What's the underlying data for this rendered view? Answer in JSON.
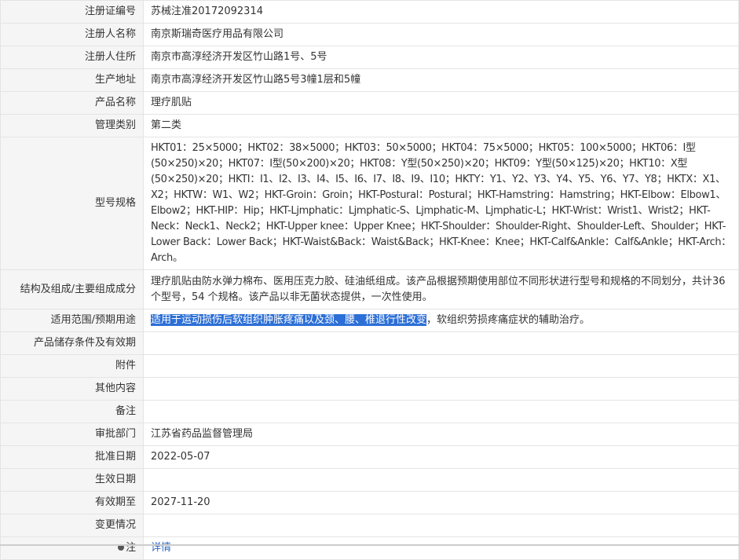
{
  "rows": [
    {
      "label": "注册证编号",
      "value": "苏械注准20172092314"
    },
    {
      "label": "注册人名称",
      "value": "南京斯瑞奇医疗用品有限公司"
    },
    {
      "label": "注册人住所",
      "value": "南京市高淳经济开发区竹山路1号、5号"
    },
    {
      "label": "生产地址",
      "value": "南京市高淳经济开发区竹山路5号3幢1层和5幢"
    },
    {
      "label": "产品名称",
      "value": "理疗肌贴"
    },
    {
      "label": "管理类别",
      "value": "第二类"
    },
    {
      "label": "型号规格",
      "value": "HKT01：25×5000；HKT02：38×5000；HKT03：50×5000；HKT04：75×5000；HKT05：100×5000；HKT06：I型(50×250)×20；HKT07：I型(50×200)×20；HKT08：Y型(50×250)×20；HKT09：Y型(50×125)×20；HKT10：X型(50×250)×20；HKTI：I1、I2、I3、I4、I5、I6、I7、I8、I9、I10；HKTY：Y1、Y2、Y3、Y4、Y5、Y6、Y7、Y8；HKTX：X1、X2；HKTW：W1、W2；HKT-Groin：Groin；HKT-Postural：Postural；HKT-Hamstring：Hamstring；HKT-Elbow：Elbow1、Elbow2；HKT-HIP：Hip；HKT-Ljmphatic：Ljmphatic-S、Ljmphatic-M、Ljmphatic-L；HKT-Wrist：Wrist1、Wrist2；HKT-Neck：Neck1、Neck2；HKT-Upper knee：Upper Knee；HKT-Shoulder：Shoulder-Right、Shoulder-Left、Shoulder；HKT-Lower Back：Lower Back；HKT-Waist&Back：Waist&Back；HKT-Knee：Knee；HKT-Calf&Ankle：Calf&Ankle；HKT-Arch：Arch。"
    },
    {
      "label": "结构及组成/主要组成成分",
      "value": "理疗肌贴由防水弹力棉布、医用压克力胶、硅油纸组成。该产品根据预期使用部位不同形状进行型号和规格的不同划分，共计36 个型号，54 个规格。该产品以非无菌状态提供，一次性使用。"
    },
    {
      "label": "适用范围/预期用途",
      "value_highlighted": "适用于运动损伤后软组织肿胀疼痛以及颈、腰、椎退行性改变",
      "value_rest": "，软组织劳损疼痛症状的辅助治疗。"
    },
    {
      "label": "产品储存条件及有效期",
      "value": ""
    },
    {
      "label": "附件",
      "value": ""
    },
    {
      "label": "其他内容",
      "value": ""
    },
    {
      "label": "备注",
      "value": ""
    },
    {
      "label": "审批部门",
      "value": "江苏省药品监督管理局"
    },
    {
      "label": "批准日期",
      "value": "2022-05-07"
    },
    {
      "label": "生效日期",
      "value": ""
    },
    {
      "label": "有效期至",
      "value": "2027-11-20"
    },
    {
      "label": "变更情况",
      "value": ""
    },
    {
      "label": "注",
      "value": "详情"
    }
  ]
}
